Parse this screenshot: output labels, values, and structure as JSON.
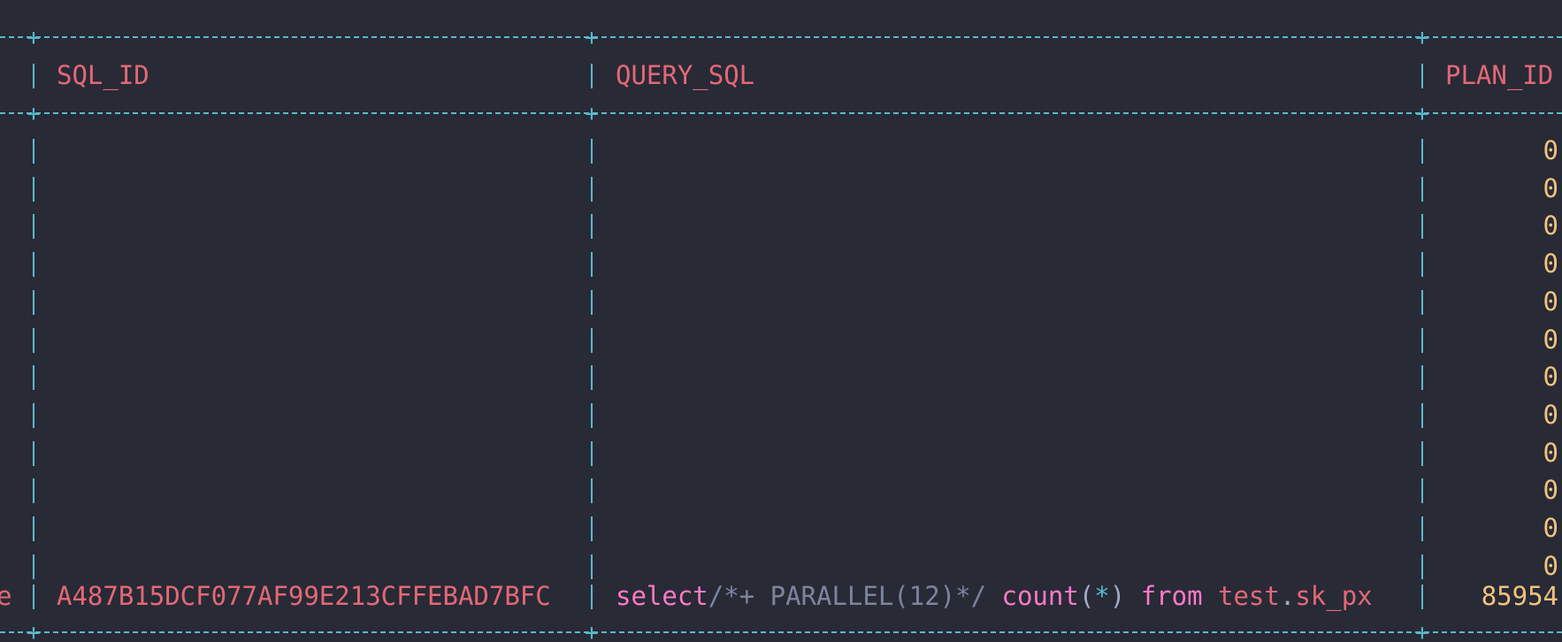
{
  "table": {
    "headers": {
      "sql_id": "SQL_ID",
      "query_sql": "QUERY_SQL",
      "plan_id": "PLAN_ID"
    },
    "empty_rows_plan_id": [
      "0",
      "0",
      "0",
      "0",
      "0",
      "0",
      "0",
      "0",
      "0",
      "0",
      "0",
      "0"
    ],
    "last_row": {
      "prev_col_tail": "e",
      "sql_id": "A487B15DCF077AF99E213CFFEBAD7BFC",
      "query_sql": {
        "kw_select": "select",
        "hint": "/*+ PARALLEL(12)*/",
        "fn_count": "count",
        "paren_open": "(",
        "star": "*",
        "paren_close": ")",
        "kw_from": "from",
        "schema": "test",
        "dot": ".",
        "table": "sk_px"
      },
      "plan_id": "85954"
    }
  },
  "colors": {
    "background": "#282a36",
    "border": "#5ab9c8",
    "header": "#e46876",
    "keyword": "#ff79c6",
    "comment": "#7c849e",
    "number": "#f1c27d"
  }
}
